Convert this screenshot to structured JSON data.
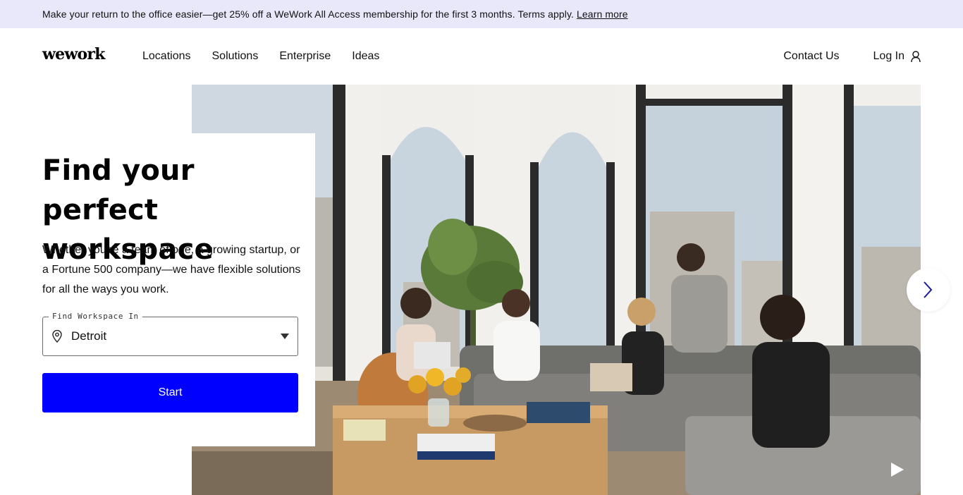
{
  "promo": {
    "text": "Make your return to the office easier—get 25% off a WeWork All Access membership for the first 3 months. Terms apply.",
    "link": "Learn more"
  },
  "nav": {
    "logo": "wework",
    "links": [
      "Locations",
      "Solutions",
      "Enterprise",
      "Ideas"
    ],
    "contact": "Contact Us",
    "login": "Log In",
    "login_icon": "user-icon"
  },
  "hero": {
    "title": "Find your perfect workspace",
    "subtitle": "Whether you’re a team of one, a growing startup, or a Fortune 500 company—we have flexible solutions for all the ways you work.",
    "field_label": "Find Workspace In",
    "location_icon": "map-pin-icon",
    "selected_location": "Detroit",
    "start_label": "Start",
    "next_icon": "chevron-right-icon",
    "play_icon": "play-icon"
  },
  "colors": {
    "promo_bg": "#e9e8fb",
    "accent": "#0000ff",
    "text": "#111111"
  }
}
